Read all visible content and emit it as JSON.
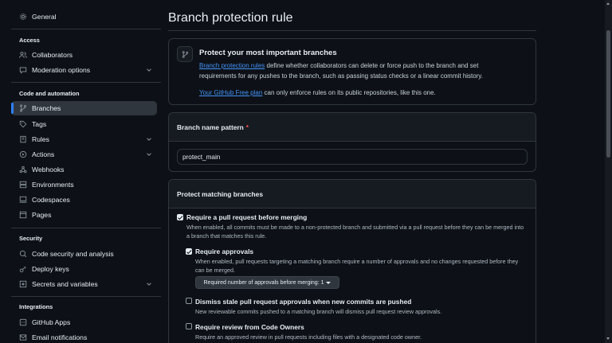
{
  "sidebar": {
    "general": "General",
    "access_heading": "Access",
    "collaborators": "Collaborators",
    "moderation": "Moderation options",
    "code_heading": "Code and automation",
    "branches": "Branches",
    "tags": "Tags",
    "rules": "Rules",
    "actions": "Actions",
    "webhooks": "Webhooks",
    "environments": "Environments",
    "codespaces": "Codespaces",
    "pages": "Pages",
    "security_heading": "Security",
    "code_security": "Code security and analysis",
    "deploy_keys": "Deploy keys",
    "secrets": "Secrets and variables",
    "integrations_heading": "Integrations",
    "github_apps": "GitHub Apps",
    "email_notifications": "Email notifications"
  },
  "main": {
    "title": "Branch protection rule",
    "info": {
      "title": "Protect your most important branches",
      "link1": "Branch protection rules",
      "text1": " define whether collaborators can delete or force push to the branch and set",
      "text2": "requirements for any pushes to the branch, such as passing status checks or a linear commit history.",
      "link2": "Your GitHub Free plan",
      "text3": " can only enforce rules on its public repositories, like this one."
    },
    "pattern": {
      "label": "Branch name pattern",
      "required_mark": "*",
      "value": "protect_main"
    },
    "protect": {
      "heading": "Protect matching branches",
      "require_pr": {
        "checked": true,
        "title": "Require a pull request before merging",
        "desc1": "When enabled, all commits must be made to a non-protected branch and submitted via a pull request before they can be merged into",
        "desc2": "a branch that matches this rule."
      },
      "require_approvals": {
        "checked": true,
        "title": "Require approvals",
        "desc1": "When enabled, pull requests targeting a matching branch require a number of approvals and no changes requested before they",
        "desc2": "can be merged.",
        "select_label": "Required number of approvals before merging: 1"
      },
      "dismiss_stale": {
        "checked": false,
        "title": "Dismiss stale pull request approvals when new commits are pushed",
        "desc": "New reviewable commits pushed to a matching branch will dismiss pull request review approvals."
      },
      "code_owners": {
        "checked": false,
        "title": "Require review from Code Owners",
        "desc": "Require an approved review in pull requests including files with a designated code owner."
      }
    }
  },
  "colors": {
    "background": "#0d1117",
    "accent": "#2f81f7",
    "link": "#4493f8",
    "required": "#f85149"
  }
}
